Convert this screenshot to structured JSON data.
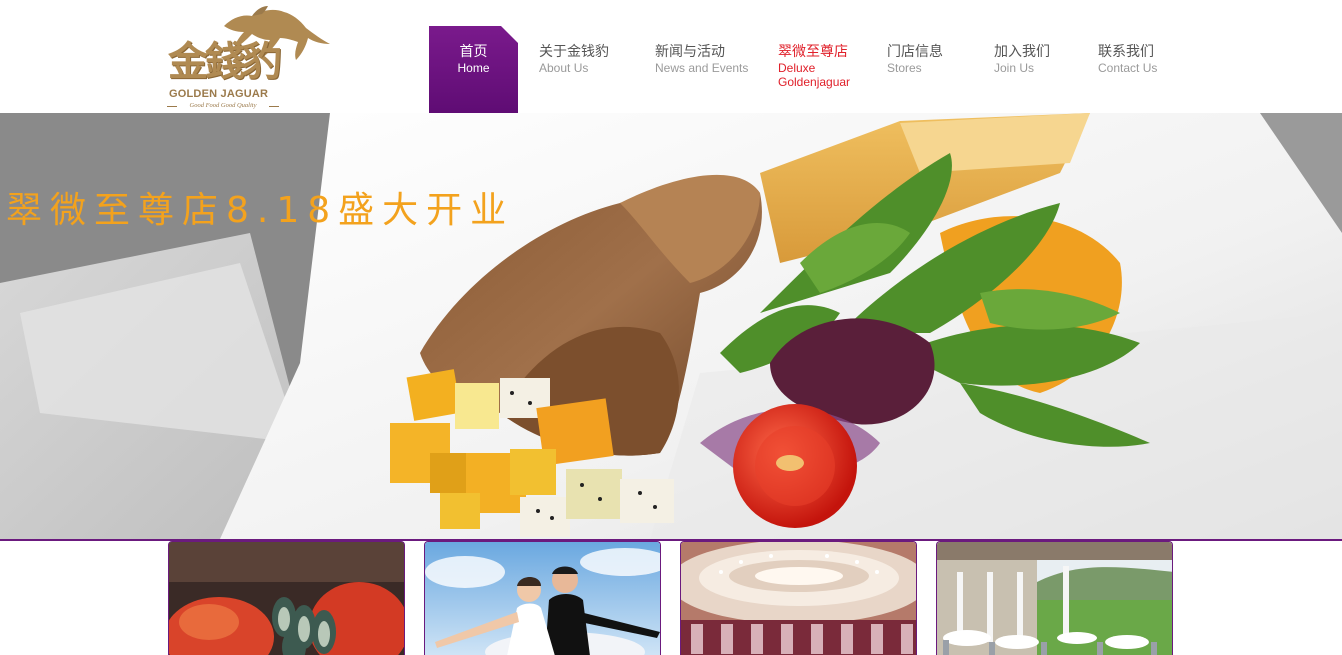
{
  "logo": {
    "cn": "金錢豹",
    "en": "GOLDEN JAGUAR",
    "slogan": "Good Food Good Quality"
  },
  "nav": {
    "items": [
      {
        "cn": "首页",
        "en": "Home",
        "active": true
      },
      {
        "cn": "关于金钱豹",
        "en": "About Us"
      },
      {
        "cn": "新闻与活动",
        "en": "News and Events"
      },
      {
        "cn": "翠微至尊店",
        "en": "Deluxe Goldenjaguar",
        "en_line1": "Deluxe",
        "en_line2": "Goldenjaguar",
        "highlight": true
      },
      {
        "cn": "门店信息",
        "en": "Stores"
      },
      {
        "cn": "加入我们",
        "en": "Join Us"
      },
      {
        "cn": "联系我们",
        "en": "Contact Us"
      }
    ]
  },
  "banner": {
    "caption": "翠微至尊店8.18盛大开业",
    "caption_color": "#f3a21d"
  },
  "thumbnails": [
    {
      "name": "seafood-buffet"
    },
    {
      "name": "wedding-couple"
    },
    {
      "name": "banquet-hall"
    },
    {
      "name": "garden-terrace"
    }
  ],
  "colors": {
    "nav_active": "#6b1a7e",
    "nav_highlight": "#e0202a",
    "brand_gold": "#b08a52",
    "divider": "#6b1a7e"
  }
}
